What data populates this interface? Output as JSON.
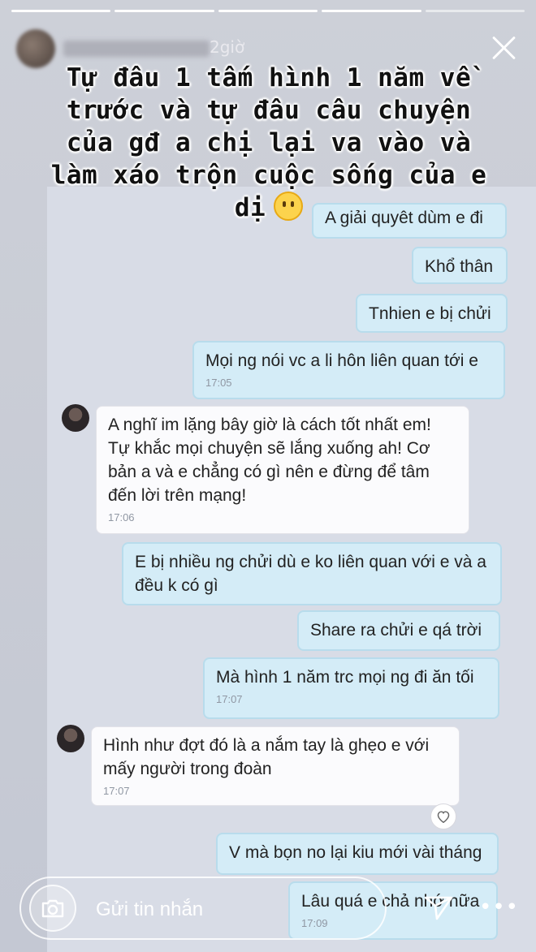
{
  "story": {
    "time_ago": "2giờ",
    "caption_lines": [
      "Tự đâu 1 tấm hình 1 năm về",
      "trước và tự đâu câu chuyện",
      "của gđ a chị lại va vào và",
      "làm xáo trộn cuộc sống của e",
      "dị"
    ],
    "emoji": "neutral-face-icon"
  },
  "messages": [
    {
      "side": "out",
      "text": "A giải quyêt dùm e đi",
      "time": ""
    },
    {
      "side": "out",
      "text": "Khổ thân",
      "time": ""
    },
    {
      "side": "out",
      "text": "Tnhien e bị chửi",
      "time": ""
    },
    {
      "side": "out",
      "text": "Mọi ng nói vc a li hôn liên quan tới e",
      "time": "17:05"
    },
    {
      "side": "in",
      "text": "A nghĩ im lặng bây giờ là cách tốt nhất em! Tự khắc mọi chuyện sẽ lắng xuống ah! Cơ bản a và e chẳng có gì nên e đừng để tâm đến lời trên mạng!",
      "time": "17:06"
    },
    {
      "side": "out",
      "text": "E bị nhiều ng chửi dù e ko liên quan với e và a đều k có gì",
      "time": ""
    },
    {
      "side": "out",
      "text": "Share ra chửi e qá trời",
      "time": ""
    },
    {
      "side": "out",
      "text": "Mà hình 1 năm trc mọi ng đi ăn tối",
      "time": "17:07"
    },
    {
      "side": "in",
      "text": "Hình như đợt đó là a nắm tay là ghẹo e với mấy người trong đoàn",
      "time": "17:07"
    },
    {
      "side": "out",
      "text": "V mà bọn no lại kiu mới vài tháng",
      "time": ""
    },
    {
      "side": "out",
      "text": "Lâu quá e chả nhớ nữa",
      "time": "17:09"
    }
  ],
  "reply": {
    "placeholder": "Gửi tin nhắn"
  },
  "more_label": "•••"
}
